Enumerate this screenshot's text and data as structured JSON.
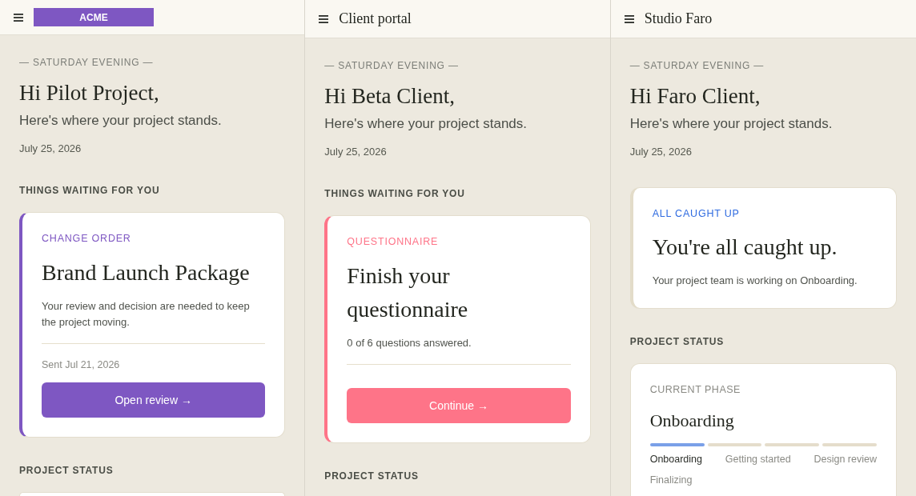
{
  "panes": [
    {
      "header": {
        "kind": "logo",
        "text": "ACME"
      },
      "eyebrow": "— SATURDAY EVENING —",
      "greeting": "Hi Pilot Project,",
      "subtitle": "Here's where your project stands.",
      "date": "July 25, 2026",
      "waiting": {
        "heading": "THINGS WAITING FOR YOU",
        "card": {
          "kind": "action",
          "color": "#7e57c2",
          "tag": "CHANGE ORDER",
          "title": "Brand Launch Package",
          "description": "Your review and decision are needed to keep the project moving.",
          "meta": "Sent Jul 21, 2026",
          "button": "Open review →"
        }
      },
      "status": {
        "heading": "PROJECT STATUS",
        "card": {
          "kind": "phase"
        }
      }
    },
    {
      "header": {
        "kind": "title",
        "text": "Client portal"
      },
      "eyebrow": "— SATURDAY EVENING —",
      "greeting": "Hi Beta Client,",
      "subtitle": "Here's where your project stands.",
      "date": "July 25, 2026",
      "waiting": {
        "heading": "THINGS WAITING FOR YOU",
        "card": {
          "kind": "action",
          "color": "#fe7488",
          "tag": "QUESTIONNAIRE",
          "title": "Finish your questionnaire",
          "description": "0 of 6 questions answered.",
          "button": "Continue →"
        }
      },
      "status": {
        "heading": "PROJECT STATUS"
      }
    },
    {
      "header": {
        "kind": "title",
        "text": "Studio Faro"
      },
      "eyebrow": "— SATURDAY EVENING —",
      "greeting": "Hi Faro Client,",
      "subtitle": "Here's where your project stands.",
      "date": "July 25, 2026",
      "waiting": {
        "card": {
          "kind": "notice",
          "color": "#2f6be0",
          "tag": "ALL CAUGHT UP",
          "title": "You're all caught up.",
          "description": "Your project team is working on Onboarding."
        }
      },
      "status": {
        "heading": "PROJECT STATUS",
        "card": {
          "kind": "phase",
          "label": "CURRENT PHASE",
          "phase": "Onboarding",
          "phases": [
            {
              "name": "Onboarding",
              "selected": true
            },
            {
              "name": "Getting started",
              "selected": false
            },
            {
              "name": "Design review",
              "selected": false
            },
            {
              "name": "Finalizing",
              "selected": false
            }
          ]
        }
      }
    }
  ]
}
